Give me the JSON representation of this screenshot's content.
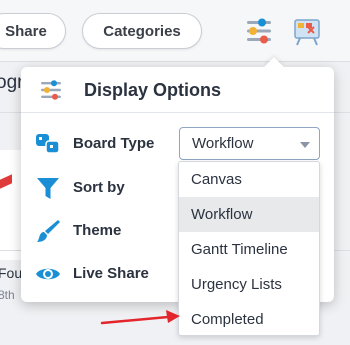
{
  "toolbar": {
    "share_label": "Share",
    "categories_label": "Categories",
    "icons": [
      "sliders-icon",
      "board-icon"
    ]
  },
  "background": {
    "partial_text_a": "ogr",
    "partial_text_b": "Fou",
    "partial_text_c": "8th"
  },
  "display_options": {
    "title": "Display Options",
    "rows": [
      {
        "label": "Board Type",
        "icon": "board-type-icon"
      },
      {
        "label": "Sort by",
        "icon": "funnel-icon"
      },
      {
        "label": "Theme",
        "icon": "paintbrush-icon"
      },
      {
        "label": "Live Share",
        "icon": "eye-icon"
      }
    ],
    "board_type_value": "Workflow",
    "options": [
      "Canvas",
      "Workflow",
      "Gantt Timeline",
      "Urgency Lists",
      "Completed"
    ],
    "selected_option": "Workflow"
  },
  "colors": {
    "accent": "#1a8fd6",
    "annotation_arrow": "#e3262b",
    "selected_bg": "#e8e9eb"
  }
}
